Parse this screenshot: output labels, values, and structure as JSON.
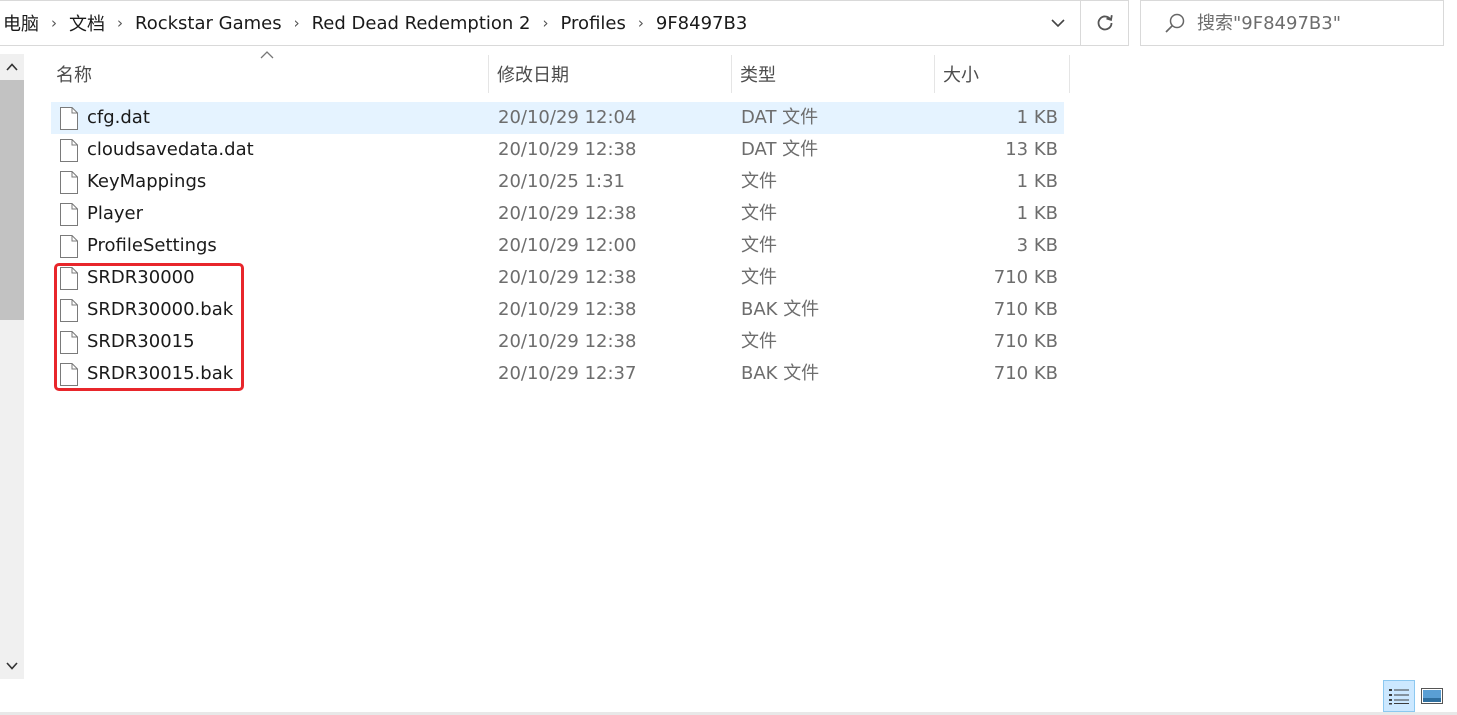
{
  "address_bar": {
    "breadcrumb": [
      "电脑",
      "文档",
      "Rockstar Games",
      "Red Dead Redemption 2",
      "Profiles",
      "9F8497B3"
    ]
  },
  "search": {
    "placeholder": "搜索\"9F8497B3\""
  },
  "columns": {
    "name": "名称",
    "date": "修改日期",
    "type": "类型",
    "size": "大小"
  },
  "files": [
    {
      "name": "cfg.dat",
      "date": "20/10/29 12:04",
      "type": "DAT 文件",
      "size": "1 KB"
    },
    {
      "name": "cloudsavedata.dat",
      "date": "20/10/29 12:38",
      "type": "DAT 文件",
      "size": "13 KB"
    },
    {
      "name": "KeyMappings",
      "date": "20/10/25 1:31",
      "type": "文件",
      "size": "1 KB"
    },
    {
      "name": "Player",
      "date": "20/10/29 12:38",
      "type": "文件",
      "size": "1 KB"
    },
    {
      "name": "ProfileSettings",
      "date": "20/10/29 12:00",
      "type": "文件",
      "size": "3 KB"
    },
    {
      "name": "SRDR30000",
      "date": "20/10/29 12:38",
      "type": "文件",
      "size": "710 KB"
    },
    {
      "name": "SRDR30000.bak",
      "date": "20/10/29 12:38",
      "type": "BAK 文件",
      "size": "710 KB"
    },
    {
      "name": "SRDR30015",
      "date": "20/10/29 12:38",
      "type": "文件",
      "size": "710 KB"
    },
    {
      "name": "SRDR30015.bak",
      "date": "20/10/29 12:37",
      "type": "BAK 文件",
      "size": "710 KB"
    }
  ],
  "colors": {
    "highlight": "#e8262b",
    "selected_row": "#e5f3ff"
  }
}
